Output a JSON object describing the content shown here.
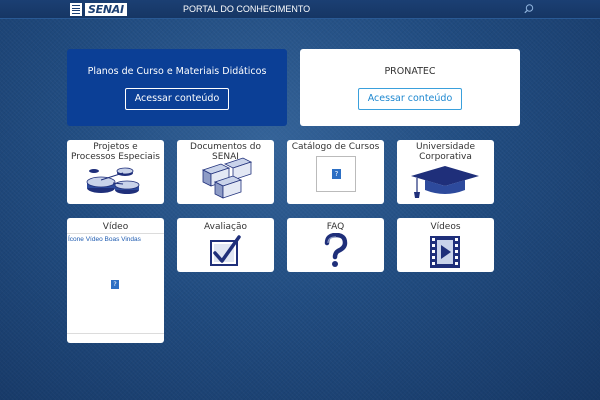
{
  "header": {
    "logo_text": "SENAI",
    "portal_title": "PORTAL DO CONHECIMENTO"
  },
  "hero": {
    "plans": {
      "title": "Planos de Curso e Materiais Didáticos",
      "button": "Acessar conteúdo"
    },
    "pronatec": {
      "title": "PRONATEC",
      "button": "Acessar conteúdo"
    }
  },
  "tiles": {
    "projetos": {
      "title": "Projetos e Processos Especiais",
      "icon": "gears-icon"
    },
    "documentos": {
      "title": "Documentos do SENAI",
      "icon": "documents-icon"
    },
    "catalogo": {
      "title": "Catálogo de Cursos",
      "icon": "broken-image-icon"
    },
    "universidade": {
      "title": "Universidade Corporativa",
      "icon": "graduation-cap-icon"
    },
    "video": {
      "title": "Vídeo",
      "alt_text": "Ícone Vídeo Boas Vindas"
    },
    "avaliacao": {
      "title": "Avaliação",
      "icon": "checkbox-check-icon"
    },
    "faq": {
      "title": "FAQ",
      "icon": "question-mark-icon"
    },
    "videos": {
      "title": "Vídeos",
      "icon": "film-play-icon"
    }
  },
  "colors": {
    "primary_blue": "#0b3f96",
    "header": "#1b3f73",
    "icon_navy": "#1f2f7a",
    "link_blue": "#1e88d0"
  }
}
